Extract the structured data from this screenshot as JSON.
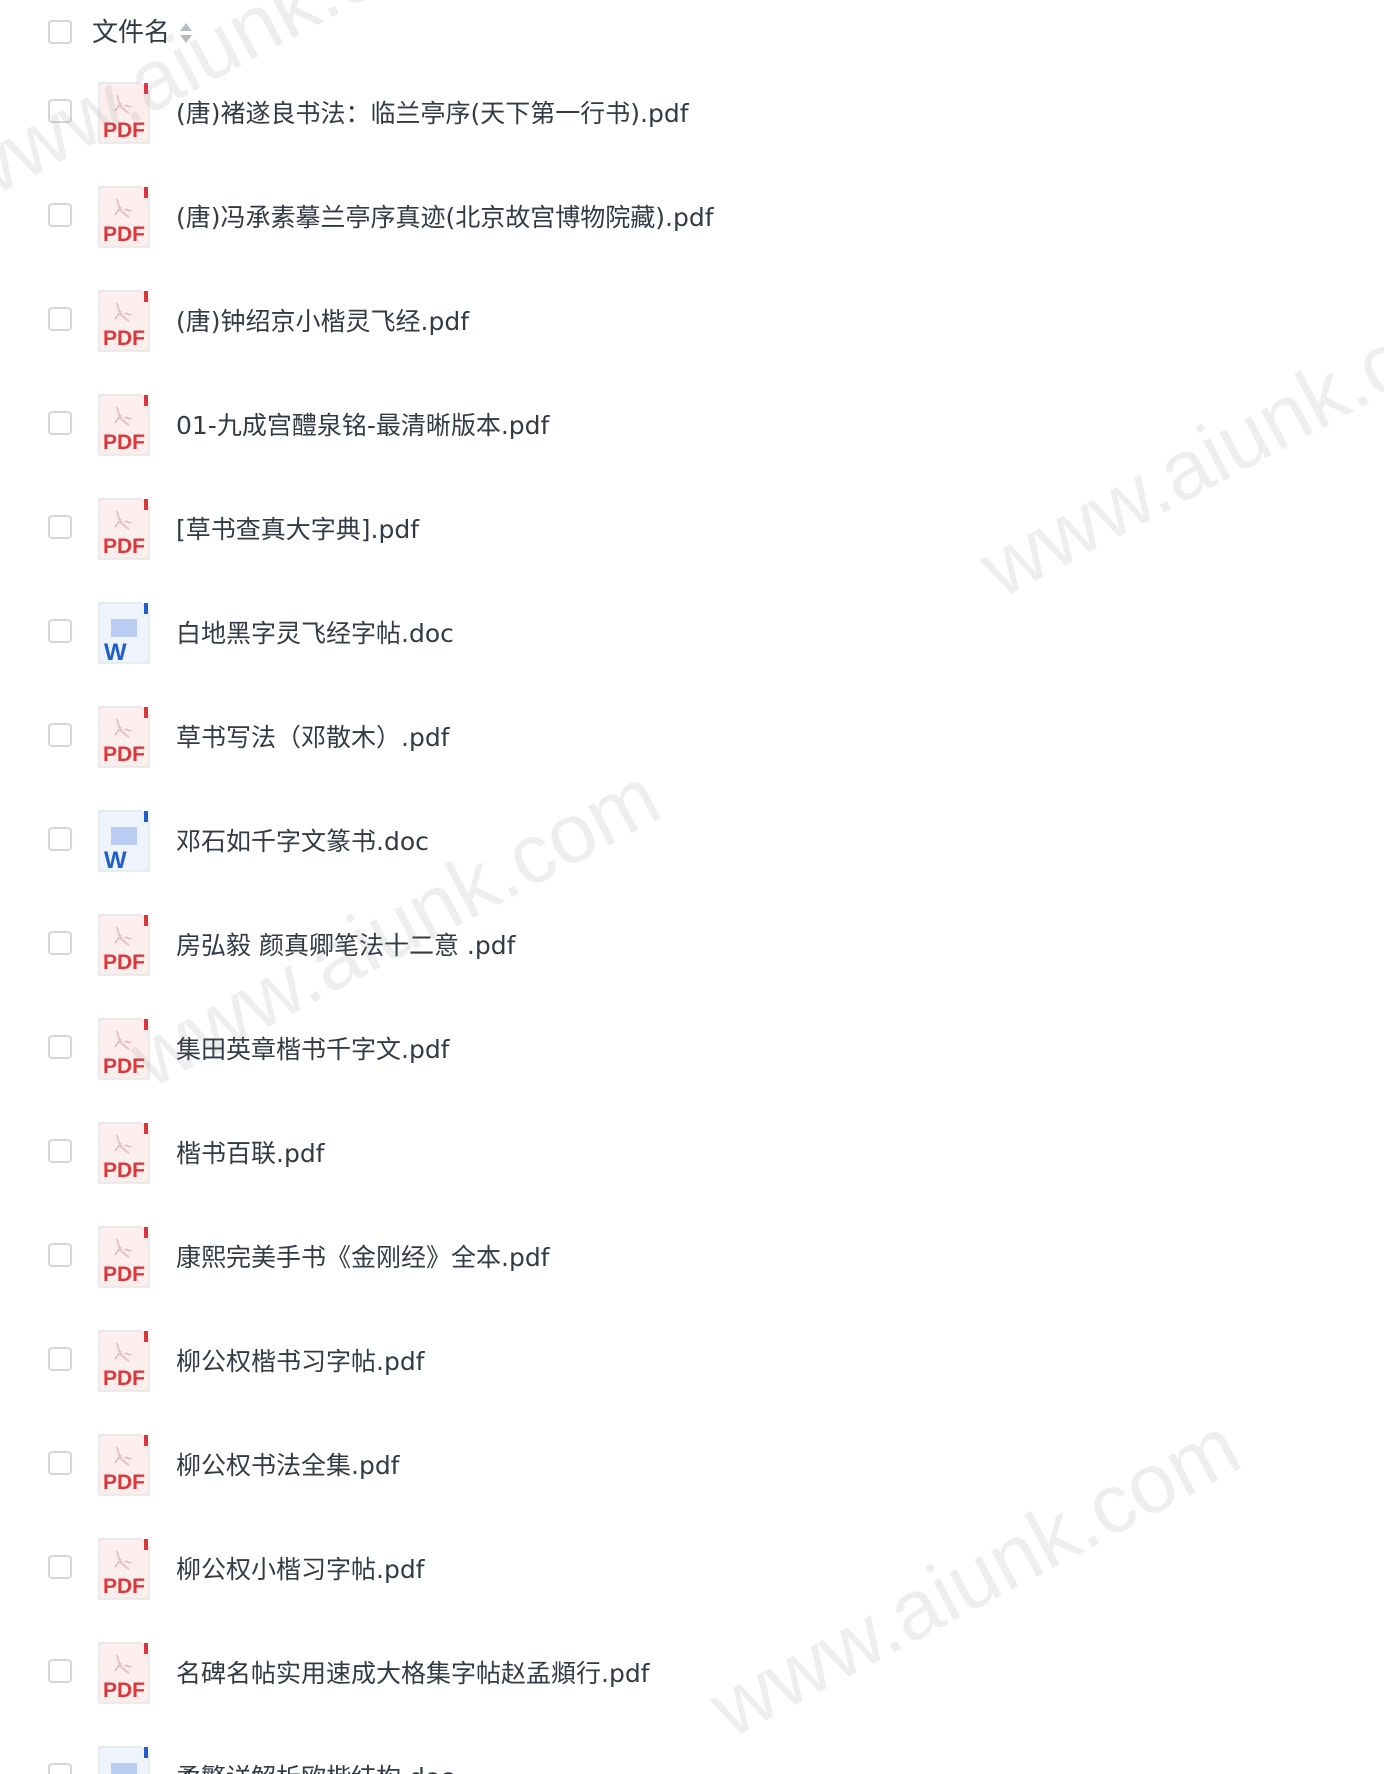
{
  "header": {
    "column_title": "文件名",
    "sort_icon": "sort-updown-icon"
  },
  "files": [
    {
      "name": "(唐)褚遂良书法：临兰亭序(天下第一行书).pdf",
      "type": "pdf"
    },
    {
      "name": "(唐)冯承素摹兰亭序真迹(北京故宫博物院藏).pdf",
      "type": "pdf"
    },
    {
      "name": "(唐)钟绍京小楷灵飞经.pdf",
      "type": "pdf"
    },
    {
      "name": "01-九成宫醴泉铭-最清晰版本.pdf",
      "type": "pdf"
    },
    {
      "name": "[草书查真大字典].pdf",
      "type": "pdf"
    },
    {
      "name": "白地黑字灵飞经字帖.doc",
      "type": "doc"
    },
    {
      "name": "草书写法（邓散木）.pdf",
      "type": "pdf"
    },
    {
      "name": "邓石如千字文篆书.doc",
      "type": "doc"
    },
    {
      "name": "房弘毅 颜真卿笔法十二意 .pdf",
      "type": "pdf"
    },
    {
      "name": "集田英章楷书千字文.pdf",
      "type": "pdf"
    },
    {
      "name": "楷书百联.pdf",
      "type": "pdf"
    },
    {
      "name": "康熙完美手书《金刚经》全本.pdf",
      "type": "pdf"
    },
    {
      "name": "柳公权楷书习字帖.pdf",
      "type": "pdf"
    },
    {
      "name": "柳公权书法全集.pdf",
      "type": "pdf"
    },
    {
      "name": "柳公权小楷习字帖.pdf",
      "type": "pdf"
    },
    {
      "name": "名碑名帖实用速成大格集字帖赵孟頫行.pdf",
      "type": "pdf"
    },
    {
      "name": "柔繁详解析欧楷结构.doc",
      "type": "doc"
    }
  ],
  "icons": {
    "pdf_label": "PDF",
    "doc_label": "W",
    "pdf_color": "#d9393c",
    "doc_color": "#1f5fc9"
  },
  "watermarks": [
    {
      "text": "www.aiunk.com"
    },
    {
      "text": "www.aiunk.com"
    },
    {
      "text": "www.aiunk.com"
    },
    {
      "text": "www.aiunk.com"
    }
  ]
}
